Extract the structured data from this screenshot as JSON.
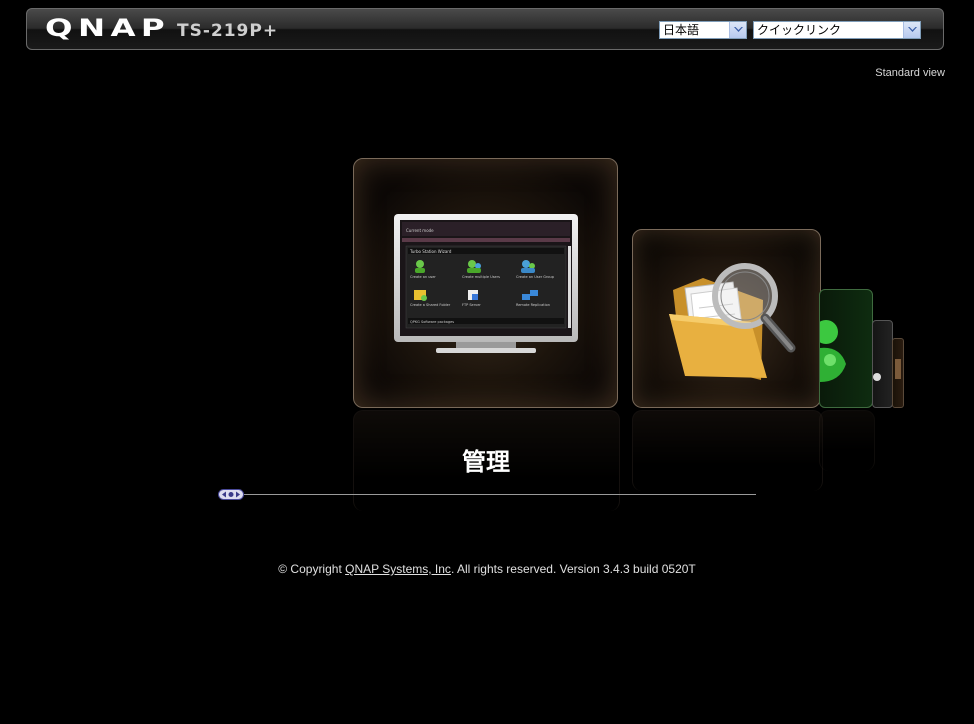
{
  "header": {
    "brand": "QNAP",
    "model": "TS-219P+",
    "language_select": {
      "value": "日本語"
    },
    "quicklink_select": {
      "value": "クイックリンク"
    }
  },
  "nav": {
    "standard_view": "Standard view"
  },
  "carousel": {
    "active_caption": "管理",
    "items": [
      {
        "name": "administration",
        "icon": "monitor-icon",
        "label": "管理"
      },
      {
        "name": "file-station",
        "icon": "folder-search-icon"
      },
      {
        "name": "download-station",
        "icon": "green-app-icon"
      },
      {
        "name": "app-4",
        "icon": "app-icon"
      },
      {
        "name": "app-5",
        "icon": "app-icon"
      }
    ],
    "monitor_screen": {
      "tab": "Current mode",
      "wizard_title": "Turbo Station Wizard",
      "items": [
        "Create an user",
        "Create multiple Users",
        "Create an User Group",
        "Create a Shared Folder",
        "FTP Server",
        "Remote Replication"
      ],
      "footer": "QPKG Software packages"
    }
  },
  "footer": {
    "copyright_prefix": "© Copyright",
    "company_link": "QNAP Systems, Inc",
    "suffix": ". All rights reserved. Version 3.4.3 build 0520T"
  }
}
